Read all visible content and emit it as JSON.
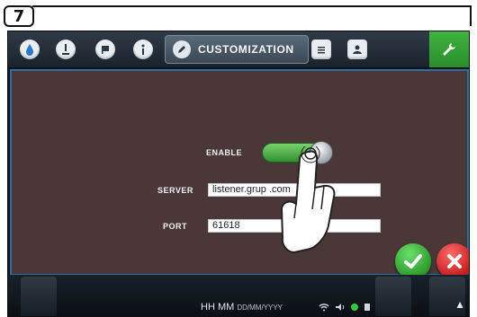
{
  "step_number": "7",
  "header": {
    "tabs": [
      {
        "name": "drop-tab",
        "icon": "drop-icon"
      },
      {
        "name": "temperature-tab",
        "icon": "thermometer-icon"
      },
      {
        "name": "flag-tab",
        "icon": "flag-icon"
      },
      {
        "name": "info-tab",
        "icon": "info-icon"
      }
    ],
    "active_tab_label": "CUSTOMIZATION",
    "right_tabs": [
      {
        "name": "list-tab",
        "icon": "list-icon"
      },
      {
        "name": "user-tab",
        "icon": "user-icon"
      }
    ],
    "settings_icon": "wrench-icon"
  },
  "form": {
    "enable_label": "ENABLE",
    "enable_state": "on",
    "server_label": "SERVER",
    "server_value": "listener.grup             .com",
    "port_label": "PORT",
    "port_value": "61618"
  },
  "actions": {
    "confirm_icon": "check-icon",
    "cancel_icon": "close-icon"
  },
  "statusbar": {
    "time": "HH MM",
    "date_format": "DD/MM/YYYY"
  },
  "colors": {
    "content_bg": "#4a3838",
    "confirm": "#2b9a2b",
    "cancel": "#c51e1e",
    "wrench_tab": "#2a8e2a"
  }
}
